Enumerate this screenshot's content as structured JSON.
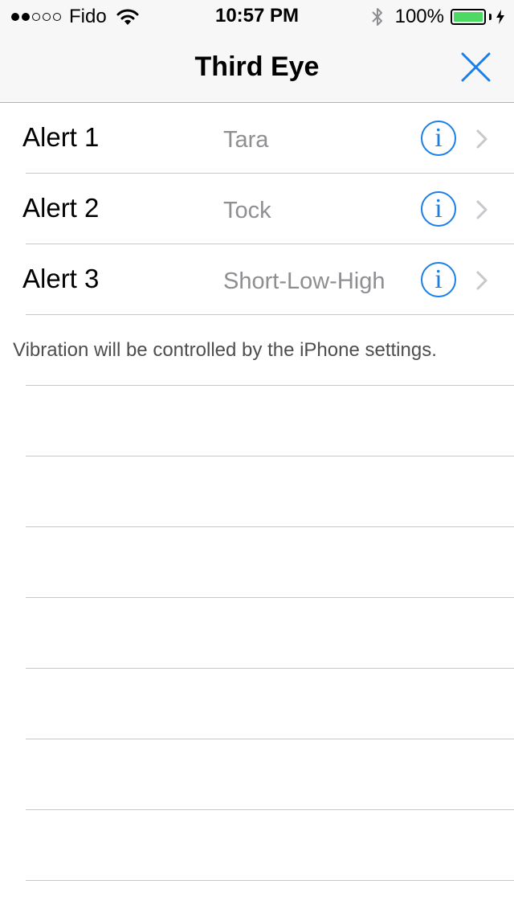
{
  "status_bar": {
    "signal_strength": 2,
    "signal_total": 5,
    "carrier": "Fido",
    "time": "10:57 PM",
    "battery": "100%",
    "wifi_icon": "wifi-icon",
    "bluetooth_icon": "bluetooth-icon",
    "charging_icon": "bolt-icon"
  },
  "nav": {
    "title": "Third Eye",
    "close_icon": "close-icon"
  },
  "alerts": [
    {
      "label": "Alert 1",
      "value": "Tara",
      "info_icon": "info-icon",
      "chevron_icon": "chevron-right-icon"
    },
    {
      "label": "Alert 2",
      "value": "Tock",
      "info_icon": "info-icon",
      "chevron_icon": "chevron-right-icon"
    },
    {
      "label": "Alert 3",
      "value": "Short-Low-High",
      "info_icon": "info-icon",
      "chevron_icon": "chevron-right-icon"
    }
  ],
  "footer_note": "Vibration will be controlled by the iPhone settings.",
  "info_glyph": "i",
  "colors": {
    "accent": "#1a7fe8",
    "secondary_text": "#8e8e93",
    "battery_fill": "#4cd964",
    "separator": "#c8c7cc",
    "bar_background": "#f7f7f7"
  }
}
